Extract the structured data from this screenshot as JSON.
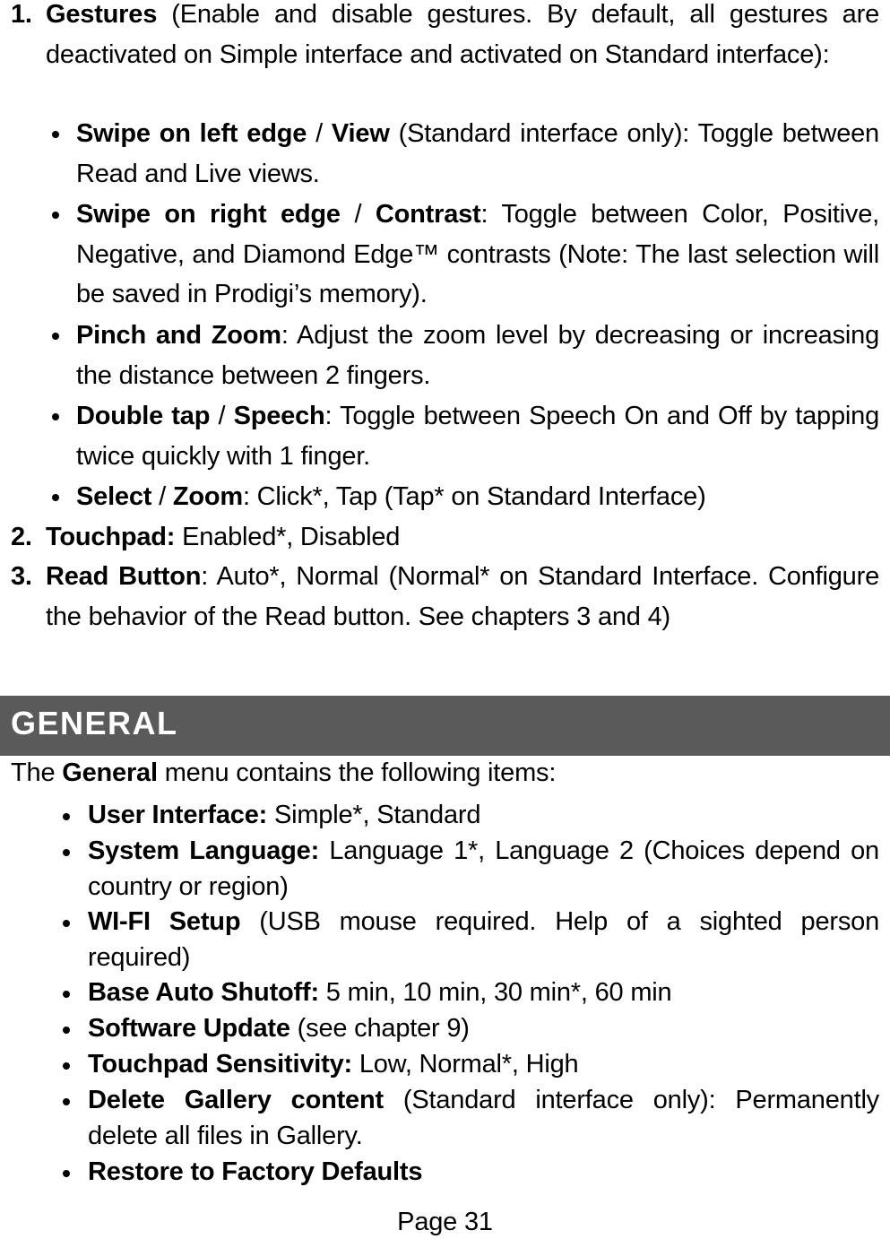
{
  "items": {
    "gestures": {
      "number": "1.",
      "title": "Gestures",
      "desc": " (Enable and disable gestures. By default, all gestures are deactivated on Simple interface and activated on Standard interface):",
      "bullets": [
        {
          "b1": "Swipe on left edge",
          "sep": " / ",
          "b2": "View",
          "text": " (Standard interface only): Toggle between Read and Live views."
        },
        {
          "b1": "Swipe on right edge",
          "sep": " / ",
          "b2": "Contrast",
          "text": ": Toggle between Color, Positive, Negative, and Diamond Edge™ contrasts (Note: The last selection will be saved in Prodigi’s memory)."
        },
        {
          "b1": "Pinch and Zoom",
          "sep": "",
          "b2": "",
          "text": ": Adjust the zoom level by decreasing or increasing the distance between 2 fingers."
        },
        {
          "b1": "Double tap",
          "sep": " / ",
          "b2": "Speech",
          "text": ": Toggle between Speech On and Off by tapping twice quickly with 1 finger."
        },
        {
          "b1": "Select",
          "sep": " / ",
          "b2": "Zoom",
          "text": ": Click*, Tap (Tap* on Standard Interface)"
        }
      ]
    },
    "touchpad": {
      "number": "2.",
      "title": "Touchpad:",
      "text": " Enabled*, Disabled"
    },
    "read_button": {
      "number": "3.",
      "title": "Read Button",
      "text": ": Auto*, Normal (Normal* on Standard Interface. Configure the behavior of the Read button. See chapters 3 and 4)"
    }
  },
  "section": {
    "title": "GENERAL",
    "intro_pre": "The ",
    "intro_bold": "General",
    "intro_post": " menu contains the following items:",
    "items": [
      {
        "bold": "User Interface:",
        "text": " Simple*, Standard"
      },
      {
        "bold": "System Language:",
        "text": " Language 1*, Language 2 (Choices depend on country or region)"
      },
      {
        "bold": "WI-FI Setup",
        "text": " (USB mouse required. Help of a sighted person required)"
      },
      {
        "bold": "Base Auto Shutoff:",
        "text": " 5 min, 10 min, 30 min*, 60 min"
      },
      {
        "bold": "Software Update",
        "text": " (see chapter 9)"
      },
      {
        "bold": "Touchpad Sensitivity:",
        "text": " Low, Normal*, High"
      },
      {
        "bold": "Delete Gallery content",
        "text": " (Standard interface only): Permanently delete all files in Gallery."
      },
      {
        "bold": "Restore to Factory Defaults",
        "text": ""
      }
    ]
  },
  "footer": {
    "page": "Page 31"
  },
  "colors": {
    "header_bg": "#5a5a5a",
    "header_text": "#ffffff"
  }
}
